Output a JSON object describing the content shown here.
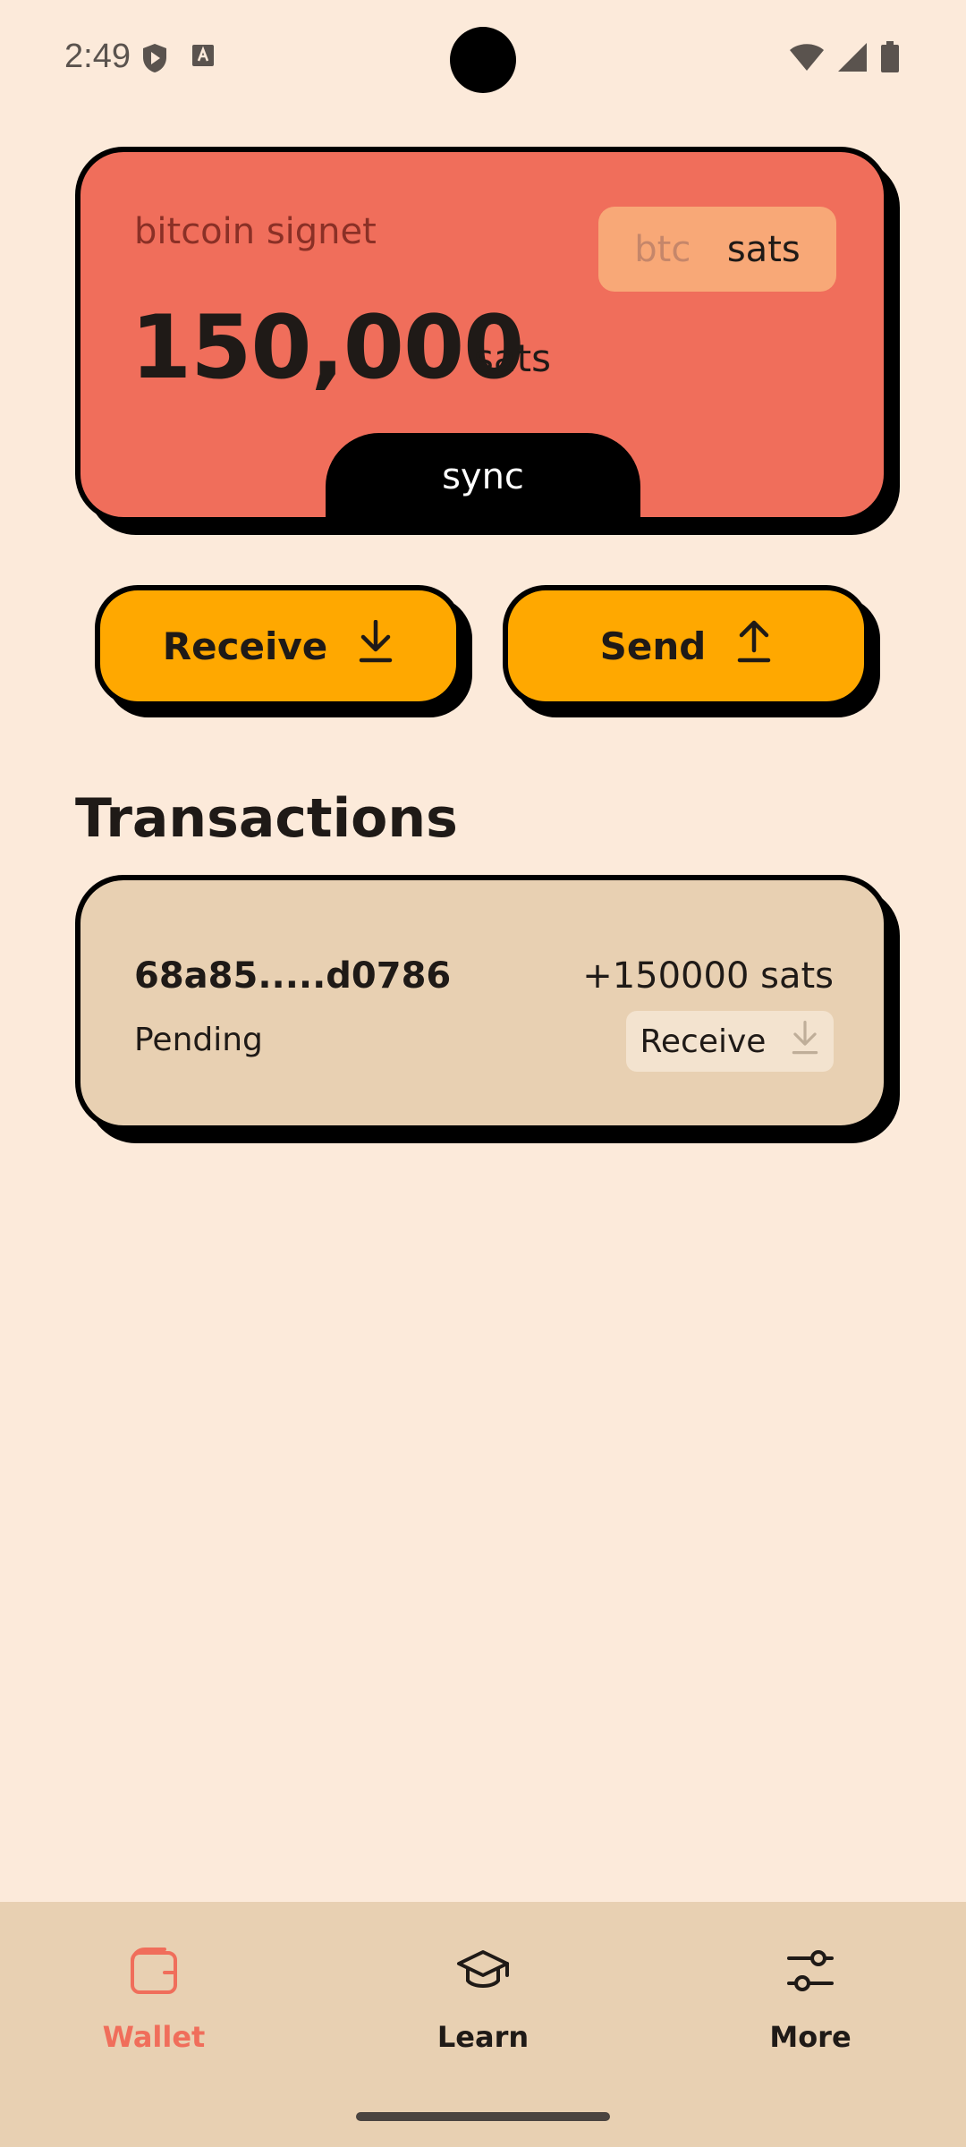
{
  "status_bar": {
    "time": "2:49"
  },
  "balance_card": {
    "network": "bitcoin signet",
    "unit_toggle": {
      "btc_label": "btc",
      "sats_label": "sats",
      "selected": "sats"
    },
    "amount": "150,000",
    "unit": "sats",
    "sync_label": "sync"
  },
  "actions": {
    "receive_label": "Receive",
    "send_label": "Send"
  },
  "transactions": {
    "title": "Transactions",
    "items": [
      {
        "txid": "68a85.....d0786",
        "amount": "+150000 sats",
        "status": "Pending",
        "type": "Receive"
      }
    ]
  },
  "bottom_nav": {
    "items": [
      {
        "label": "Wallet",
        "icon": "wallet-icon",
        "active": true
      },
      {
        "label": "Learn",
        "icon": "graduation-cap-icon",
        "active": false
      },
      {
        "label": "More",
        "icon": "sliders-icon",
        "active": false
      }
    ]
  },
  "colors": {
    "background": "#fceada",
    "balance_card": "#f06e5b",
    "action_button": "#ffa800",
    "tx_card": "#e8d0b2",
    "active_nav": "#f06e5b"
  }
}
